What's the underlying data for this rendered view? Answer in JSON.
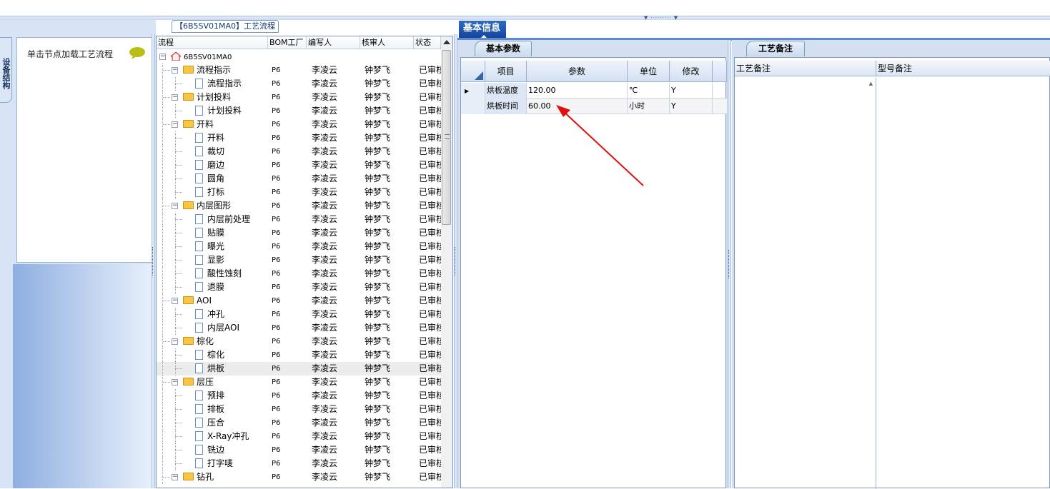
{
  "left": {
    "vertical_tab": "设备结构",
    "hint": "单击节点加载工艺流程"
  },
  "tree": {
    "caption": "【6B5SV01MA0】工艺流程",
    "columns": [
      "流程",
      "BOM工厂",
      "编写人",
      "核审人",
      "状态"
    ],
    "rows": [
      {
        "level": 0,
        "type": "root",
        "name": "6B5SV01MA0",
        "bom": "",
        "author": "",
        "reviewer": "",
        "status": ""
      },
      {
        "level": 1,
        "type": "folder",
        "name": "流程指示",
        "bom": "P6",
        "author": "李凌云",
        "reviewer": "钟梦飞",
        "status": "已审核"
      },
      {
        "level": 2,
        "type": "doc",
        "name": "流程指示",
        "bom": "P6",
        "author": "李凌云",
        "reviewer": "钟梦飞",
        "status": "已审核"
      },
      {
        "level": 1,
        "type": "folder",
        "name": "计划投料",
        "bom": "P6",
        "author": "李凌云",
        "reviewer": "钟梦飞",
        "status": "已审核"
      },
      {
        "level": 2,
        "type": "doc",
        "name": "计划投料",
        "bom": "P6",
        "author": "李凌云",
        "reviewer": "钟梦飞",
        "status": "已审核"
      },
      {
        "level": 1,
        "type": "folder",
        "name": "开料",
        "bom": "P6",
        "author": "李凌云",
        "reviewer": "钟梦飞",
        "status": "已审核"
      },
      {
        "level": 2,
        "type": "doc",
        "name": "开料",
        "bom": "P6",
        "author": "李凌云",
        "reviewer": "钟梦飞",
        "status": "已审核"
      },
      {
        "level": 2,
        "type": "doc",
        "name": "裁切",
        "bom": "P6",
        "author": "李凌云",
        "reviewer": "钟梦飞",
        "status": "已审核"
      },
      {
        "level": 2,
        "type": "doc",
        "name": "磨边",
        "bom": "P6",
        "author": "李凌云",
        "reviewer": "钟梦飞",
        "status": "已审核"
      },
      {
        "level": 2,
        "type": "doc",
        "name": "圆角",
        "bom": "P6",
        "author": "李凌云",
        "reviewer": "钟梦飞",
        "status": "已审核"
      },
      {
        "level": 2,
        "type": "doc",
        "name": "打标",
        "bom": "P6",
        "author": "李凌云",
        "reviewer": "钟梦飞",
        "status": "已审核"
      },
      {
        "level": 1,
        "type": "folder",
        "name": "内层图形",
        "bom": "P6",
        "author": "李凌云",
        "reviewer": "钟梦飞",
        "status": "已审核"
      },
      {
        "level": 2,
        "type": "doc",
        "name": "内层前处理",
        "bom": "P6",
        "author": "李凌云",
        "reviewer": "钟梦飞",
        "status": "已审核"
      },
      {
        "level": 2,
        "type": "doc",
        "name": "贴膜",
        "bom": "P6",
        "author": "李凌云",
        "reviewer": "钟梦飞",
        "status": "已审核"
      },
      {
        "level": 2,
        "type": "doc",
        "name": "曝光",
        "bom": "P6",
        "author": "李凌云",
        "reviewer": "钟梦飞",
        "status": "已审核"
      },
      {
        "level": 2,
        "type": "doc",
        "name": "显影",
        "bom": "P6",
        "author": "李凌云",
        "reviewer": "钟梦飞",
        "status": "已审核"
      },
      {
        "level": 2,
        "type": "doc",
        "name": "酸性蚀刻",
        "bom": "P6",
        "author": "李凌云",
        "reviewer": "钟梦飞",
        "status": "已审核"
      },
      {
        "level": 2,
        "type": "doc",
        "name": "退膜",
        "bom": "P6",
        "author": "李凌云",
        "reviewer": "钟梦飞",
        "status": "已审核"
      },
      {
        "level": 1,
        "type": "folder",
        "name": "AOI",
        "bom": "P6",
        "author": "李凌云",
        "reviewer": "钟梦飞",
        "status": "已审核"
      },
      {
        "level": 2,
        "type": "doc",
        "name": "冲孔",
        "bom": "P6",
        "author": "李凌云",
        "reviewer": "钟梦飞",
        "status": "已审核"
      },
      {
        "level": 2,
        "type": "doc",
        "name": "内层AOI",
        "bom": "P6",
        "author": "李凌云",
        "reviewer": "钟梦飞",
        "status": "已审核"
      },
      {
        "level": 1,
        "type": "folder",
        "name": "棕化",
        "bom": "P6",
        "author": "李凌云",
        "reviewer": "钟梦飞",
        "status": "已审核"
      },
      {
        "level": 2,
        "type": "doc",
        "name": "棕化",
        "bom": "P6",
        "author": "李凌云",
        "reviewer": "钟梦飞",
        "status": "已审核"
      },
      {
        "level": 2,
        "type": "doc",
        "name": "烘板",
        "bom": "P6",
        "author": "李凌云",
        "reviewer": "钟梦飞",
        "status": "已审核",
        "selected": true
      },
      {
        "level": 1,
        "type": "folder",
        "name": "层压",
        "bom": "P6",
        "author": "李凌云",
        "reviewer": "钟梦飞",
        "status": "已审核"
      },
      {
        "level": 2,
        "type": "doc",
        "name": "预排",
        "bom": "P6",
        "author": "李凌云",
        "reviewer": "钟梦飞",
        "status": "已审核"
      },
      {
        "level": 2,
        "type": "doc",
        "name": "排板",
        "bom": "P6",
        "author": "李凌云",
        "reviewer": "钟梦飞",
        "status": "已审核"
      },
      {
        "level": 2,
        "type": "doc",
        "name": "压合",
        "bom": "P6",
        "author": "李凌云",
        "reviewer": "钟梦飞",
        "status": "已审核"
      },
      {
        "level": 2,
        "type": "doc",
        "name": "X-Ray冲孔",
        "bom": "P6",
        "author": "李凌云",
        "reviewer": "钟梦飞",
        "status": "已审核"
      },
      {
        "level": 2,
        "type": "doc",
        "name": "铣边",
        "bom": "P6",
        "author": "李凌云",
        "reviewer": "钟梦飞",
        "status": "已审核"
      },
      {
        "level": 2,
        "type": "doc",
        "name": "打字唛",
        "bom": "P6",
        "author": "李凌云",
        "reviewer": "钟梦飞",
        "status": "已审核"
      },
      {
        "level": 1,
        "type": "folder",
        "name": "钻孔",
        "bom": "P6",
        "author": "李凌云",
        "reviewer": "钟梦飞",
        "status": "已审核"
      }
    ]
  },
  "basic_info": {
    "tab": "基本信息",
    "subtab": "基本参数",
    "columns": [
      "项目",
      "参数",
      "单位",
      "修改"
    ],
    "rows": [
      {
        "item": "烘板温度",
        "param": "120.00",
        "unit": "℃",
        "modify": "Y"
      },
      {
        "item": "烘板时间",
        "param": "60.00",
        "unit": "小时",
        "modify": "Y"
      }
    ]
  },
  "notes": {
    "tab": "工艺备注",
    "columns": [
      "工艺备注",
      "型号备注"
    ]
  },
  "colors": {
    "accent": "#1d55ac",
    "annotation_arrow": "#e01010",
    "folder": "#f8c642"
  }
}
